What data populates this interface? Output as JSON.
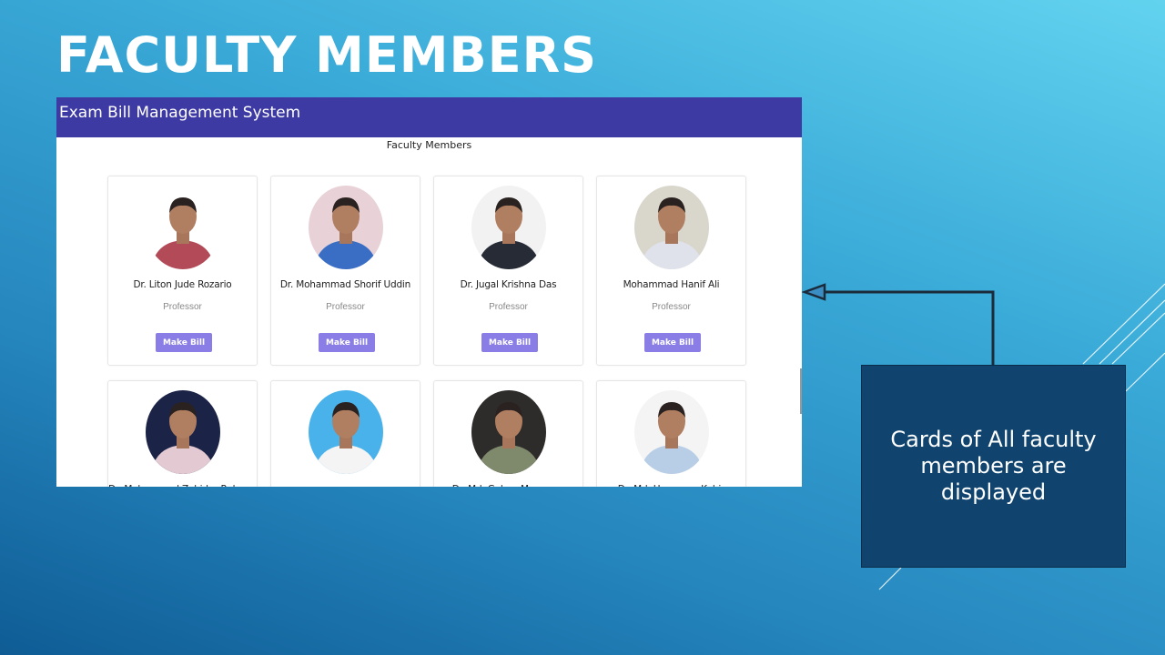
{
  "slide": {
    "title": "FACULTY MEMBERS",
    "callout": "Cards of All faculty members are displayed"
  },
  "app": {
    "header_title": "Exam Bill Management System",
    "page_heading": "Faculty Members",
    "button_label": "Make Bill",
    "faculty": [
      {
        "name": "Dr. Liton Jude Rozario",
        "role": "Professor",
        "shirt_color": "#b24a57",
        "bg_color": "#ffffff"
      },
      {
        "name": "Dr. Mohammad Shorif Uddin",
        "role": "Professor",
        "shirt_color": "#3a6ec4",
        "bg_color": "#e8d2d8"
      },
      {
        "name": "Dr. Jugal Krishna Das",
        "role": "Professor",
        "shirt_color": "#262b36",
        "bg_color": "#f2f2f2"
      },
      {
        "name": "Mohammad Hanif Ali",
        "role": "Professor",
        "shirt_color": "#dfe2ea",
        "bg_color": "#d9d6cc"
      },
      {
        "name": "Dr. Mohammad Zahidur Rahman",
        "role": "",
        "shirt_color": "#e3c9d1",
        "bg_color": "#1b2347"
      },
      {
        "name": "",
        "role": "",
        "shirt_color": "#f4f4f4",
        "bg_color": "#4ab2ea"
      },
      {
        "name": "Dr. Md. Golam Moazzam",
        "role": "",
        "shirt_color": "#7f8a6c",
        "bg_color": "#2e2c2a"
      },
      {
        "name": "Dr. Md. Humayun Kabir",
        "role": "",
        "shirt_color": "#b8cde6",
        "bg_color": "#f4f4f4"
      }
    ]
  },
  "colors": {
    "app_header": "#3d3aa3",
    "button": "#8a7ee6",
    "callout_bg": "#10446e"
  }
}
